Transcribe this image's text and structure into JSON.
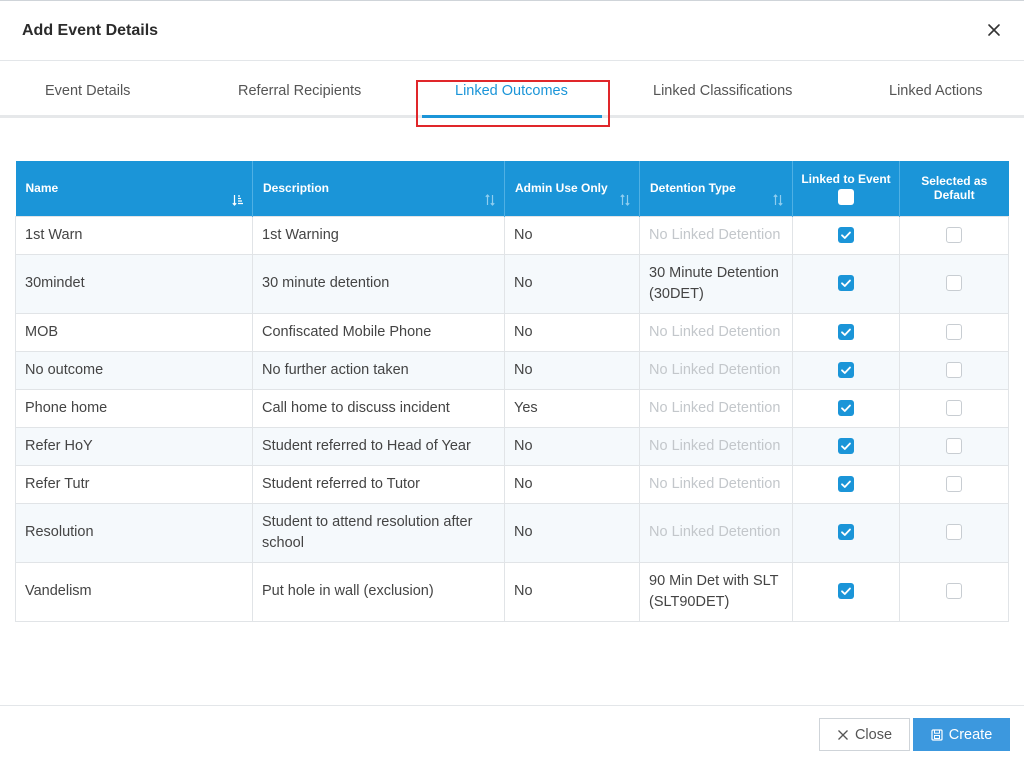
{
  "dialog": {
    "title": "Add Event Details"
  },
  "tabs": [
    {
      "label": "Event Details",
      "active": false
    },
    {
      "label": "Referral Recipients",
      "active": false
    },
    {
      "label": "Linked Outcomes",
      "active": true
    },
    {
      "label": "Linked Classifications",
      "active": false
    },
    {
      "label": "Linked Actions",
      "active": false
    }
  ],
  "table": {
    "headers": {
      "name": "Name",
      "description": "Description",
      "admin_use_only": "Admin Use Only",
      "detention_type": "Detention Type",
      "linked_to_event": "Linked to Event",
      "selected_as_default": "Selected as Default"
    },
    "rows": [
      {
        "name": "1st Warn",
        "description": "1st Warning",
        "admin": "No",
        "detention": "No Linked Detention",
        "detention_linked": false,
        "linked": true,
        "default": false
      },
      {
        "name": "30mindet",
        "description": "30 minute detention",
        "admin": "No",
        "detention": "30 Minute Detention (30DET)",
        "detention_linked": true,
        "linked": true,
        "default": false
      },
      {
        "name": "MOB",
        "description": "Confiscated Mobile Phone",
        "admin": "No",
        "detention": "No Linked Detention",
        "detention_linked": false,
        "linked": true,
        "default": false
      },
      {
        "name": "No outcome",
        "description": "No further action taken",
        "admin": "No",
        "detention": "No Linked Detention",
        "detention_linked": false,
        "linked": true,
        "default": false
      },
      {
        "name": "Phone home",
        "description": "Call home to discuss incident",
        "admin": "Yes",
        "detention": "No Linked Detention",
        "detention_linked": false,
        "linked": true,
        "default": false
      },
      {
        "name": "Refer HoY",
        "description": "Student referred to Head of Year",
        "admin": "No",
        "detention": "No Linked Detention",
        "detention_linked": false,
        "linked": true,
        "default": false
      },
      {
        "name": "Refer Tutr",
        "description": "Student referred to Tutor",
        "admin": "No",
        "detention": "No Linked Detention",
        "detention_linked": false,
        "linked": true,
        "default": false
      },
      {
        "name": "Resolution",
        "description": "Student to attend resolution after school",
        "admin": "No",
        "detention": "No Linked Detention",
        "detention_linked": false,
        "linked": true,
        "default": false
      },
      {
        "name": "Vandelism",
        "description": "Put hole in wall (exclusion)",
        "admin": "No",
        "detention": "90 Min Det with SLT (SLT90DET)",
        "detention_linked": true,
        "linked": true,
        "default": false
      }
    ]
  },
  "footer": {
    "close_label": "Close",
    "create_label": "Create"
  },
  "colors": {
    "accent": "#1b95d8",
    "highlight_border": "#e0262a",
    "button_primary": "#3c98de"
  }
}
